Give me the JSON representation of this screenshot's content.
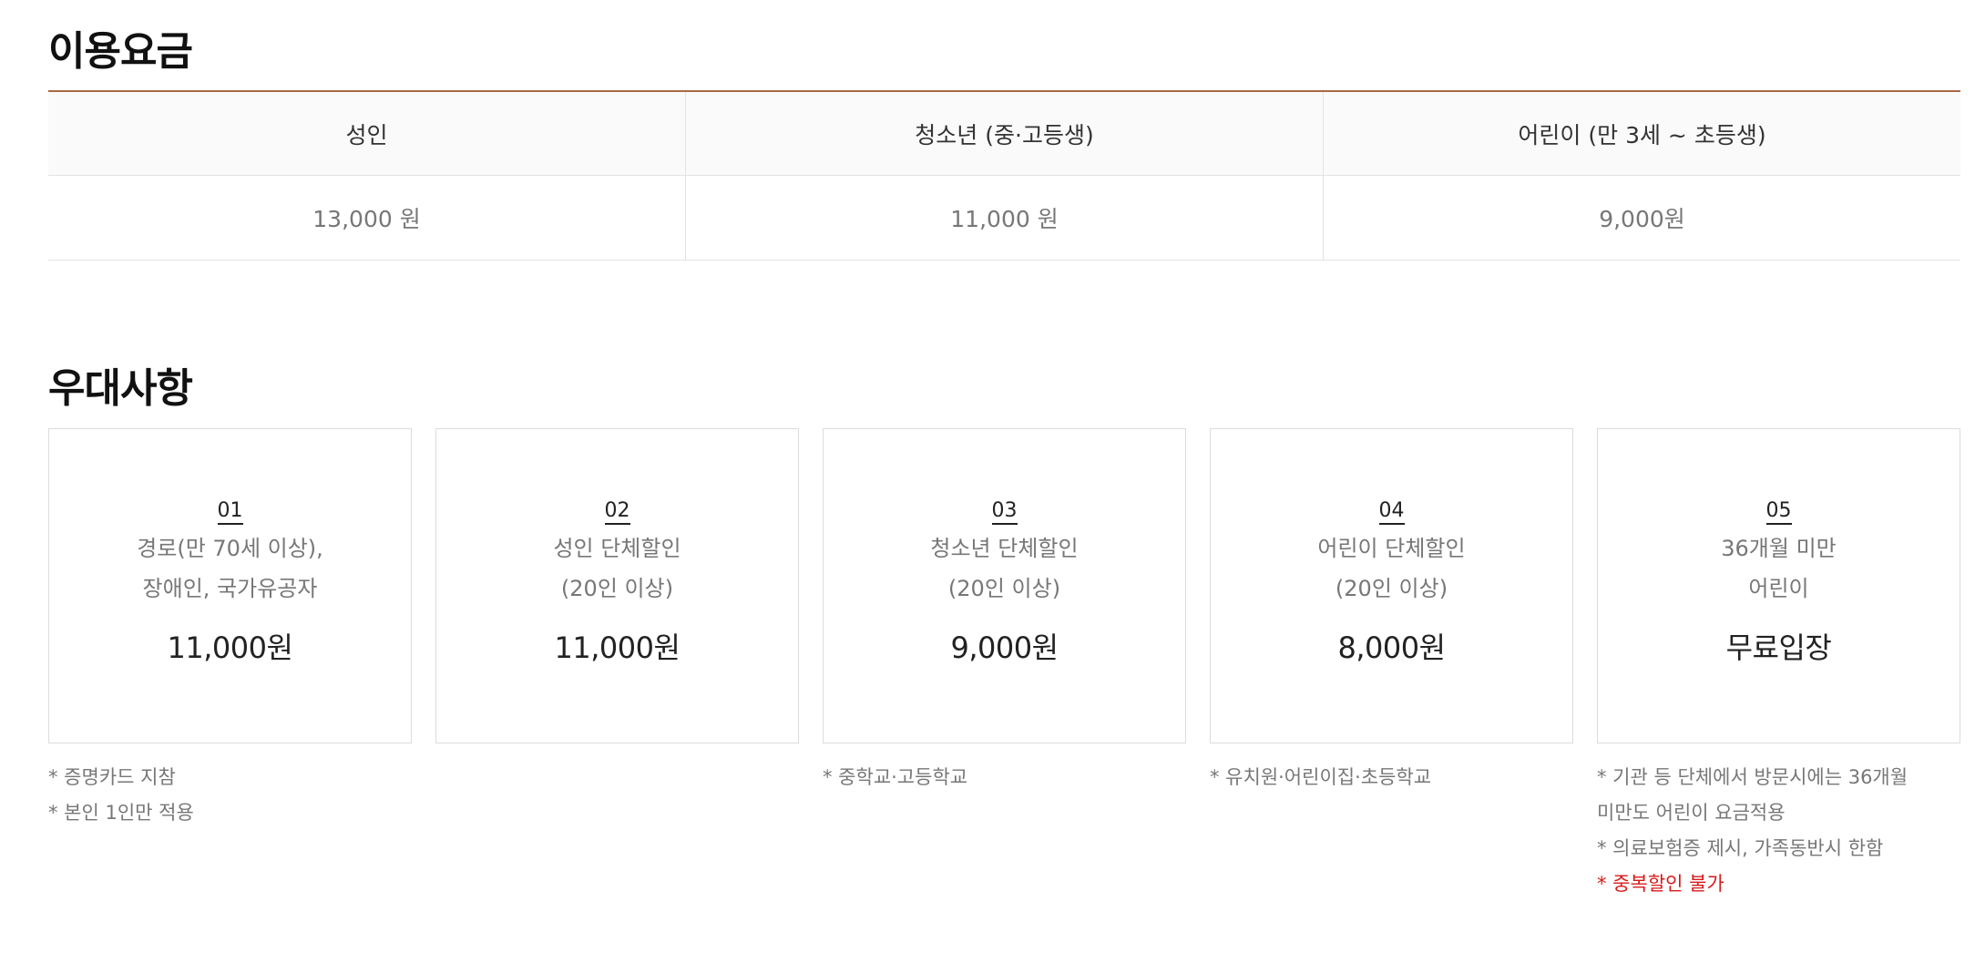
{
  "fees": {
    "title": "이용요금",
    "headers": [
      "성인",
      "청소년 (중·고등생)",
      "어린이 (만 3세 ~ 초등생)"
    ],
    "values": [
      "13,000 원",
      "11,000 원",
      "9,000원"
    ]
  },
  "benefits": {
    "title": "우대사항",
    "cards": [
      {
        "num": "01",
        "desc": [
          "경로(만 70세 이상),",
          "장애인, 국가유공자"
        ],
        "price": "11,000원",
        "notes": [
          "* 증명카드 지참",
          "* 본인 1인만 적용"
        ]
      },
      {
        "num": "02",
        "desc": [
          "성인 단체할인",
          "(20인 이상)"
        ],
        "price": "11,000원",
        "notes": []
      },
      {
        "num": "03",
        "desc": [
          "청소년 단체할인",
          "(20인 이상)"
        ],
        "price": "9,000원",
        "notes": [
          "* 중학교·고등학교"
        ]
      },
      {
        "num": "04",
        "desc": [
          "어린이 단체할인",
          "(20인 이상)"
        ],
        "price": "8,000원",
        "notes": [
          "* 유치원·어린이집·초등학교"
        ]
      },
      {
        "num": "05",
        "desc": [
          "36개월 미만",
          "어린이"
        ],
        "price": "무료입장",
        "notes": [
          "* 기관 등 단체에서 방문시에는 36개월",
          "미만도 어린이 요금적용",
          "* 의료보험증 제시, 가족동반시 한함"
        ],
        "warning": "* 중복할인 불가"
      }
    ]
  },
  "colors": {
    "accent_line": "#a86a44",
    "warning_text": "#d71a1a"
  }
}
